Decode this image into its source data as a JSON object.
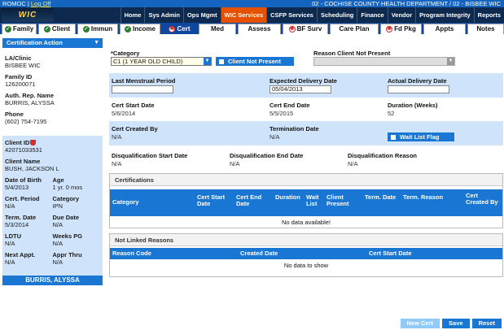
{
  "topbar": {
    "user": "ROMOC",
    "logoff": "Log Off",
    "dept": "02 - COCHISE COUNTY HEALTH DEPARTMENT / 02 - BISBEE WIC"
  },
  "logo": "WIC",
  "topnav": [
    "Home",
    "Sys Admin",
    "Ops Mgmt",
    "WIC Services",
    "CSFP Services",
    "Scheduling",
    "Finance",
    "Vendor",
    "Program Integrity",
    "Reports"
  ],
  "topnav_active": "WIC Services",
  "tabs": [
    {
      "label": "Family",
      "status": "ok"
    },
    {
      "label": "Client",
      "status": "ok"
    },
    {
      "label": "Immun",
      "status": "ok"
    },
    {
      "label": "Income",
      "status": "ok"
    },
    {
      "label": "Cert",
      "status": "bad"
    },
    {
      "label": "Med",
      "status": "none"
    },
    {
      "label": "Assess",
      "status": "none"
    },
    {
      "label": "BF Surv",
      "status": "bad"
    },
    {
      "label": "Care Plan",
      "status": "none"
    },
    {
      "label": "Fd Pkg",
      "status": "bad"
    },
    {
      "label": "Appts",
      "status": "none"
    },
    {
      "label": "Notes",
      "status": "none"
    }
  ],
  "sidebar": {
    "header": "Certification Action",
    "la_clinic_label": "LA/Clinic",
    "la_clinic": "BISBEE WIC",
    "family_id_label": "Family ID",
    "family_id": "126200071",
    "auth_rep_label": "Auth. Rep. Name",
    "auth_rep": "BURRIS, ALYSSA",
    "phone_label": "Phone",
    "phone": "(602) 754-7195",
    "client_id_label": "Client ID",
    "client_id": "42071033531",
    "client_name_label": "Client Name",
    "client_name": "BUSH, JACKSON L",
    "dob_label": "Date of Birth",
    "dob": "5/4/2013",
    "age_label": "Age",
    "age": "1 yr. 0 mos",
    "cert_period_label": "Cert. Period",
    "cert_period": "N/A",
    "category_label": "Category",
    "category": "IPN",
    "term_date_label": "Term. Date",
    "term_date": "5/3/2014",
    "due_date_label": "Due Date",
    "due_date": "N/A",
    "ldtu_label": "LDTU",
    "ldtu": "N/A",
    "weeks_pg_label": "Weeks PG",
    "weeks_pg": "N/A",
    "next_appt_label": "Next Appt.",
    "next_appt": "N/A",
    "appr_thru_label": "Appr Thru",
    "appr_thru": "N/A",
    "footer_name": "BURRIS, ALYSSA"
  },
  "form": {
    "category_label": "*Category",
    "category_value": "C1 (1 YEAR OLD CHILD)",
    "client_not_present": "Client Not Present",
    "reason_not_present_label": "Reason Client Not Present",
    "reason_not_present_value": "",
    "lmp_label": "Last Menstrual Period",
    "lmp_value": "",
    "edd_label": "Expected Delivery Date",
    "edd_value": "05/04/2013",
    "add_label": "Actual Delivery Date",
    "add_value": "",
    "cert_start_label": "Cert Start Date",
    "cert_start": "5/6/2014",
    "cert_end_label": "Cert End Date",
    "cert_end": "5/5/2015",
    "duration_label": "Duration (Weeks)",
    "duration": "52",
    "created_by_label": "Cert Created By",
    "created_by": "N/A",
    "termination_label": "Termination Date",
    "termination": "N/A",
    "wait_list_flag": "Wait List Flag",
    "disq_start_label": "Disqualification Start Date",
    "disq_start": "N/A",
    "disq_end_label": "Disqualification End Date",
    "disq_end": "N/A",
    "disq_reason_label": "Disqualification Reason",
    "disq_reason": "N/A"
  },
  "certifications": {
    "title": "Certifications",
    "columns": [
      "Category",
      "Cert Start Date",
      "Cert End Date",
      "Duration",
      "Wait List",
      "Client Present",
      "Term. Date",
      "Term. Reason",
      "Cert Created By"
    ],
    "empty": "No data available!"
  },
  "not_linked": {
    "title": "Not Linked Reasons",
    "columns": [
      "Reason Code",
      "Created Date",
      "Cert Start Date"
    ],
    "empty": "No data to show"
  },
  "buttons": {
    "new_cert": "New Cert",
    "save": "Save",
    "reset": "Reset"
  },
  "colors": {
    "primary": "#1976d2",
    "nav_dark": "#0d2a4e",
    "active_orange": "#e65100",
    "light_blue": "#cfe3fa"
  }
}
